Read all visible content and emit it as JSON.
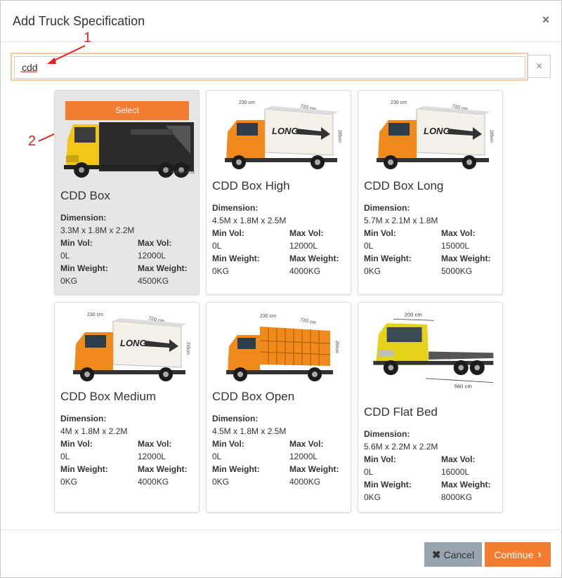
{
  "modal": {
    "title": "Add Truck Specification",
    "close_glyph": "×"
  },
  "search": {
    "value": "cdd",
    "clear_glyph": "×"
  },
  "annotations": {
    "one": "1",
    "two": "2",
    "color": "#e8201c"
  },
  "spec_labels": {
    "dimension": "Dimension:",
    "min_vol": "Min Vol:",
    "max_vol": "Max Vol:",
    "min_weight": "Min Weight:",
    "max_weight": "Max Weight:"
  },
  "select_label": "Select",
  "image_credit": "ktbfuso.co.id",
  "trucks": [
    {
      "name": "CDD Box",
      "dimension": "3.3M x 1.8M x 2.2M",
      "min_vol": "0L",
      "max_vol": "12000L",
      "min_weight": "0KG",
      "max_weight": "4500KG",
      "image": "yellow-box-truck",
      "selected": true
    },
    {
      "name": "CDD Box High",
      "dimension": "4.5M x 1.8M x 2.5M",
      "min_vol": "0L",
      "max_vol": "12000L",
      "min_weight": "0KG",
      "max_weight": "4000KG",
      "image": "orange-box-truck",
      "dim_labels": {
        "a": "230 cm",
        "b": "720 cm",
        "c": "265cm"
      },
      "box_text": "LONG"
    },
    {
      "name": "CDD Box Long",
      "dimension": "5.7M x 2.1M x 1.8M",
      "min_vol": "0L",
      "max_vol": "15000L",
      "min_weight": "0KG",
      "max_weight": "5000KG",
      "image": "orange-box-truck",
      "dim_labels": {
        "a": "230 cm",
        "b": "720 cm",
        "c": "265cm"
      },
      "box_text": "LONG"
    },
    {
      "name": "CDD Box Medium",
      "dimension": "4M x 1.8M x 2.2M",
      "min_vol": "0L",
      "max_vol": "12000L",
      "min_weight": "0KG",
      "max_weight": "4000KG",
      "image": "orange-box-truck",
      "dim_labels": {
        "a": "230 cm",
        "b": "720 cm",
        "c": "255cm"
      },
      "box_text": "LONG"
    },
    {
      "name": "CDD Box Open",
      "dimension": "4.5M x 1.8M x 2.5M",
      "min_vol": "0L",
      "max_vol": "12000L",
      "min_weight": "0KG",
      "max_weight": "4000KG",
      "image": "orange-open-truck",
      "dim_labels": {
        "a": "230 cm",
        "b": "720 cm",
        "c": "260cm"
      }
    },
    {
      "name": "CDD Flat Bed",
      "dimension": "5.6M x 2.2M x 2.2M",
      "min_vol": "0L",
      "max_vol": "16000L",
      "min_weight": "0KG",
      "max_weight": "8000KG",
      "image": "yellow-flatbed-truck",
      "dim_labels": {
        "a": "200 cm",
        "b": "560 cm"
      }
    }
  ],
  "footer": {
    "cancel_label": "Cancel",
    "continue_label": "Continue",
    "cancel_icon": "times-icon",
    "continue_icon": "chevron-right-icon"
  },
  "colors": {
    "accent": "#f47c2f",
    "cancel_bg": "#98a4ae",
    "selected_bg": "#e6e6e6"
  }
}
